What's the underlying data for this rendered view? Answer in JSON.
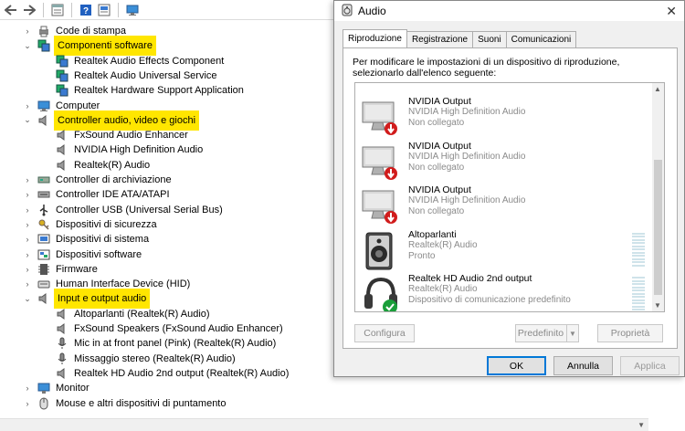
{
  "device_manager": {
    "tree": [
      {
        "label": "Code di stampa",
        "indent": 0,
        "expander": "›",
        "icon": "printer-queue-icon",
        "highlight": false
      },
      {
        "label": "Componenti software",
        "indent": 0,
        "expander": "⌄",
        "icon": "software-components-icon",
        "highlight": true
      },
      {
        "label": "Realtek Audio Effects Component",
        "indent": 1,
        "expander": "",
        "icon": "software-component-icon",
        "highlight": false
      },
      {
        "label": "Realtek Audio Universal Service",
        "indent": 1,
        "expander": "",
        "icon": "software-component-icon",
        "highlight": false
      },
      {
        "label": "Realtek Hardware Support Application",
        "indent": 1,
        "expander": "",
        "icon": "software-component-icon",
        "highlight": false
      },
      {
        "label": "Computer",
        "indent": 0,
        "expander": "›",
        "icon": "computer-icon",
        "highlight": false
      },
      {
        "label": "Controller audio, video e giochi",
        "indent": 0,
        "expander": "⌄",
        "icon": "speaker-icon",
        "highlight": true
      },
      {
        "label": "FxSound Audio Enhancer",
        "indent": 1,
        "expander": "",
        "icon": "speaker-icon",
        "highlight": false
      },
      {
        "label": "NVIDIA High Definition Audio",
        "indent": 1,
        "expander": "",
        "icon": "speaker-icon",
        "highlight": false
      },
      {
        "label": "Realtek(R) Audio",
        "indent": 1,
        "expander": "",
        "icon": "speaker-icon",
        "highlight": false
      },
      {
        "label": "Controller di archiviazione",
        "indent": 0,
        "expander": "›",
        "icon": "storage-controller-icon",
        "highlight": false
      },
      {
        "label": "Controller IDE ATA/ATAPI",
        "indent": 0,
        "expander": "›",
        "icon": "ide-controller-icon",
        "highlight": false
      },
      {
        "label": "Controller USB (Universal Serial Bus)",
        "indent": 0,
        "expander": "›",
        "icon": "usb-icon",
        "highlight": false
      },
      {
        "label": "Dispositivi di sicurezza",
        "indent": 0,
        "expander": "›",
        "icon": "security-key-icon",
        "highlight": false
      },
      {
        "label": "Dispositivi di sistema",
        "indent": 0,
        "expander": "›",
        "icon": "system-devices-icon",
        "highlight": false
      },
      {
        "label": "Dispositivi software",
        "indent": 0,
        "expander": "›",
        "icon": "software-devices-icon",
        "highlight": false
      },
      {
        "label": "Firmware",
        "indent": 0,
        "expander": "›",
        "icon": "firmware-icon",
        "highlight": false
      },
      {
        "label": "Human Interface Device (HID)",
        "indent": 0,
        "expander": "›",
        "icon": "hid-icon",
        "highlight": false
      },
      {
        "label": "Input e output audio",
        "indent": 0,
        "expander": "⌄",
        "icon": "speaker-icon",
        "highlight": true
      },
      {
        "label": "Altoparlanti (Realtek(R) Audio)",
        "indent": 1,
        "expander": "",
        "icon": "speaker-icon",
        "highlight": false
      },
      {
        "label": "FxSound Speakers (FxSound Audio Enhancer)",
        "indent": 1,
        "expander": "",
        "icon": "speaker-icon",
        "highlight": false
      },
      {
        "label": "Mic in at front panel (Pink) (Realtek(R) Audio)",
        "indent": 1,
        "expander": "",
        "icon": "microphone-icon",
        "highlight": false
      },
      {
        "label": "Missaggio stereo (Realtek(R) Audio)",
        "indent": 1,
        "expander": "",
        "icon": "microphone-icon",
        "highlight": false
      },
      {
        "label": "Realtek HD Audio 2nd output (Realtek(R) Audio)",
        "indent": 1,
        "expander": "",
        "icon": "speaker-icon",
        "highlight": false
      },
      {
        "label": "Monitor",
        "indent": 0,
        "expander": "›",
        "icon": "monitor-icon",
        "highlight": false
      },
      {
        "label": "Mouse e altri dispositivi di puntamento",
        "indent": 0,
        "expander": "›",
        "icon": "mouse-icon",
        "highlight": false
      }
    ]
  },
  "audio_dialog": {
    "title": "Audio",
    "tabs": [
      "Riproduzione",
      "Registrazione",
      "Suoni",
      "Comunicazioni"
    ],
    "active_tab": "Riproduzione",
    "intro_text": "Per modificare le impostazioni di un dispositivo di riproduzione, selezionarlo dall'elenco seguente:",
    "devices": [
      {
        "name": "NVIDIA Output",
        "driver": "NVIDIA High Definition Audio",
        "status": "Non collegato",
        "icon": "monitor-disconnected-icon"
      },
      {
        "name": "NVIDIA Output",
        "driver": "NVIDIA High Definition Audio",
        "status": "Non collegato",
        "icon": "monitor-disconnected-icon"
      },
      {
        "name": "NVIDIA Output",
        "driver": "NVIDIA High Definition Audio",
        "status": "Non collegato",
        "icon": "monitor-disconnected-icon"
      },
      {
        "name": "Altoparlanti",
        "driver": "Realtek(R) Audio",
        "status": "Pronto",
        "icon": "speaker-device-icon"
      },
      {
        "name": "Realtek HD Audio 2nd output",
        "driver": "Realtek(R) Audio",
        "status": "Dispositivo di comunicazione predefinito",
        "icon": "headset-default-icon"
      }
    ],
    "buttons": {
      "configure": "Configura",
      "default": "Predefinito",
      "properties": "Proprietà",
      "ok": "OK",
      "cancel": "Annulla",
      "apply": "Applica"
    },
    "close_glyph": "✕"
  },
  "colors": {
    "highlight": "#ffe600",
    "dialog_bg": "#f0f0f0",
    "accent": "#0078d7",
    "disconnect_red": "#d11c1c",
    "default_green": "#1a9e3a"
  }
}
